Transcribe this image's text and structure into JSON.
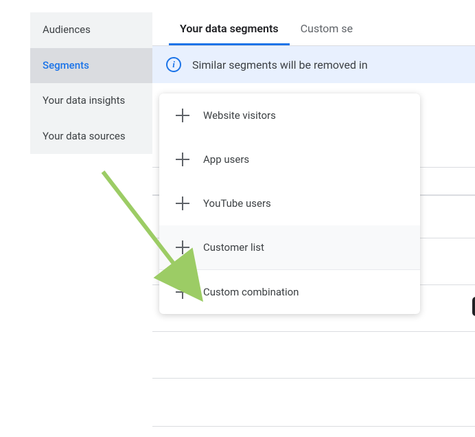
{
  "sidebar": {
    "items": [
      {
        "label": "Audiences"
      },
      {
        "label": "Segments"
      },
      {
        "label": "Your data insights"
      },
      {
        "label": "Your data sources"
      }
    ]
  },
  "tabs": [
    {
      "label": "Your data segments"
    },
    {
      "label": "Custom se"
    }
  ],
  "banner": {
    "text": "Similar segments will be removed in"
  },
  "menu": {
    "items": [
      {
        "label": "Website visitors"
      },
      {
        "label": "App users"
      },
      {
        "label": "YouTube users"
      },
      {
        "label": "Customer list"
      },
      {
        "label": "Custom combination"
      }
    ]
  }
}
